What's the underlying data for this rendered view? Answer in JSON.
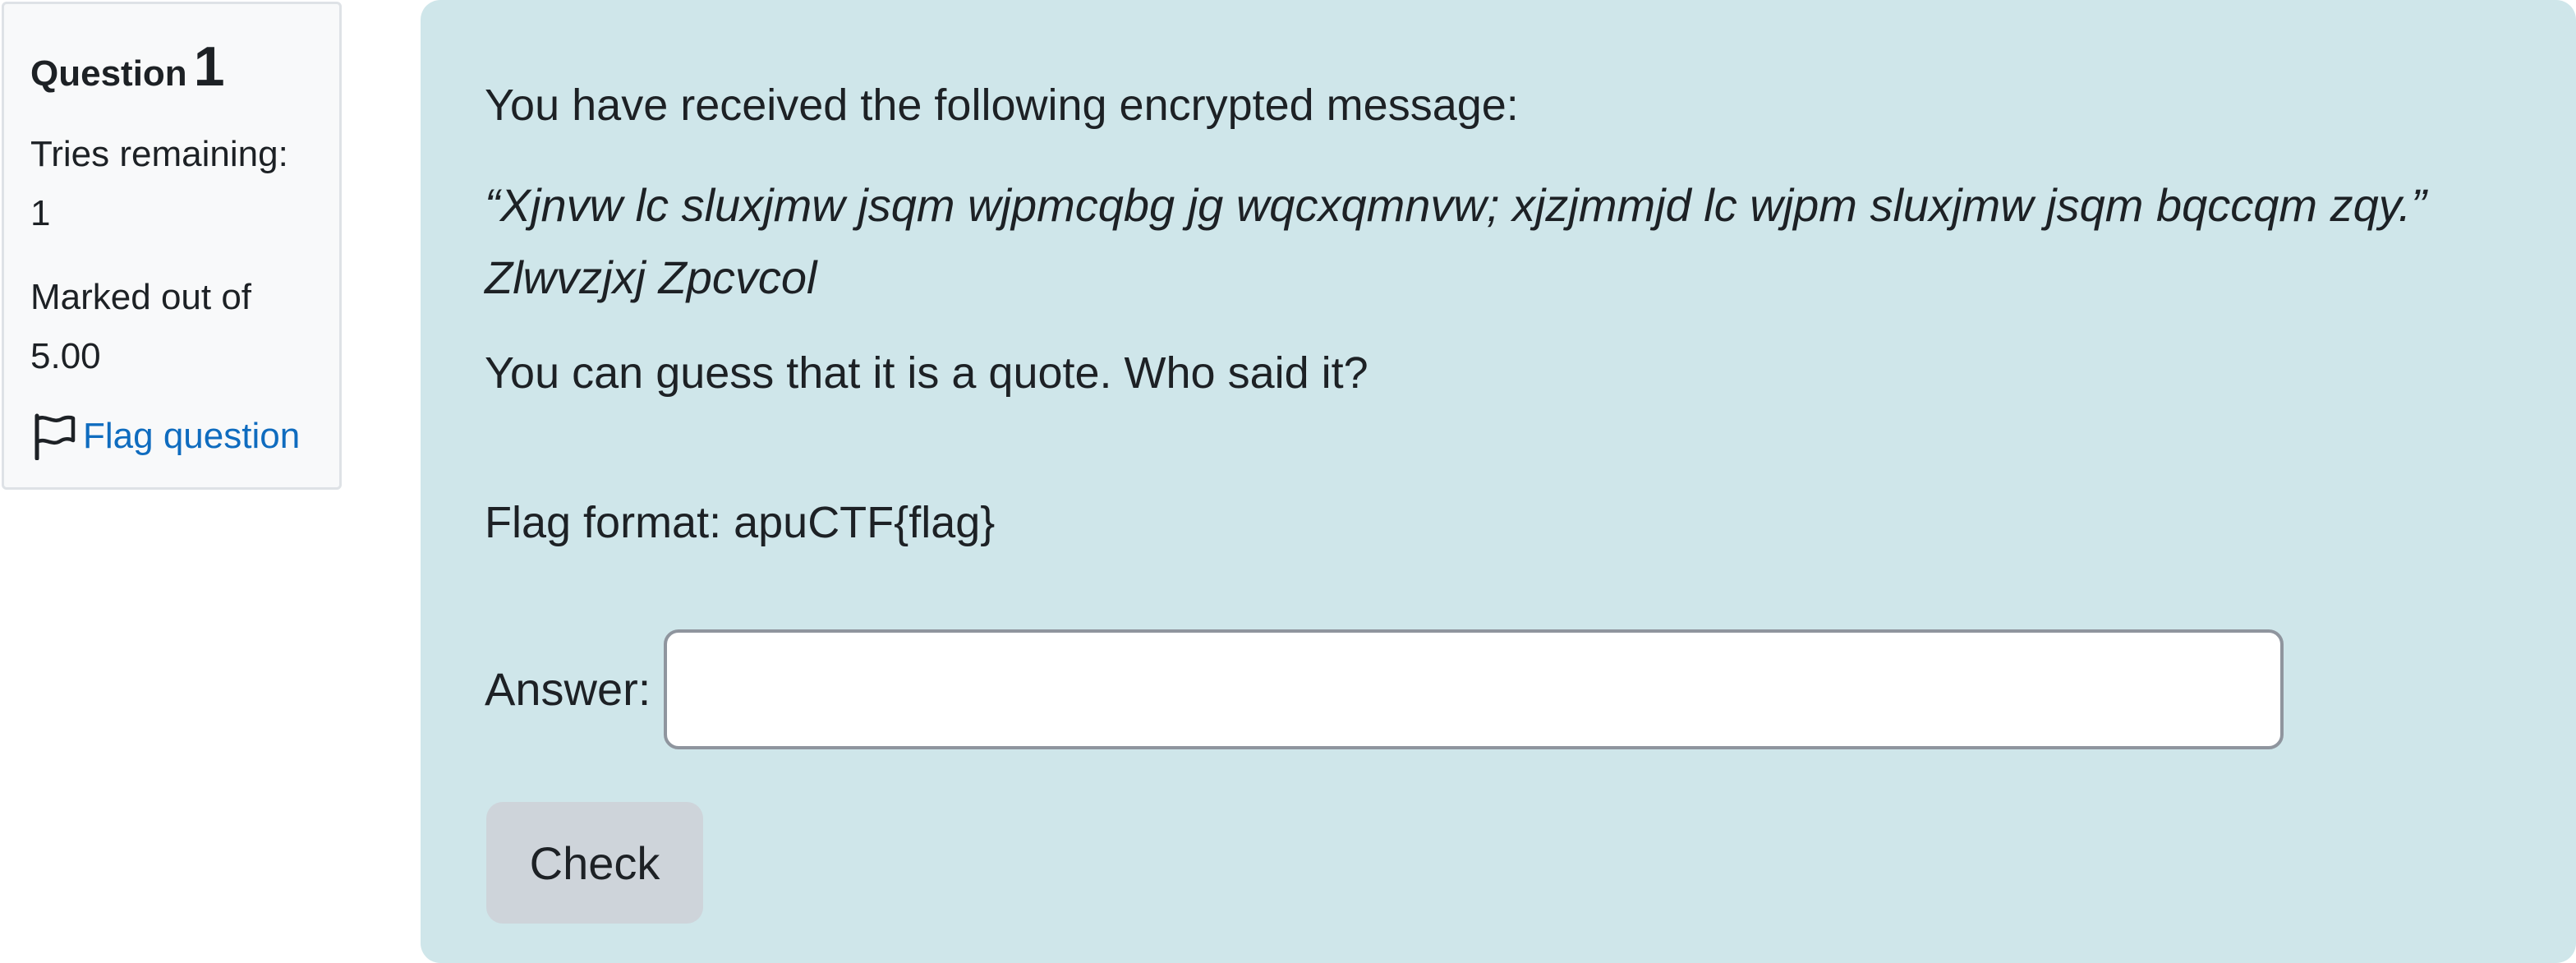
{
  "info": {
    "question_word": "Question",
    "question_number": "1",
    "state": "Tries remaining: 1",
    "grade": "Marked out of 5.00",
    "flag_label": "Flag question",
    "flag_icon": "flag-outline-icon"
  },
  "question": {
    "intro": "You have received the following encrypted message:",
    "quote_line1": "“Xjnvw lc sluxjmw jsqm wjpmcqbg jg wqcxqmnvw; xjzjmmjd lc wjpm sluxjmw jsqm bqccqm zqy.”",
    "quote_line2": "Zlwvzjxj Zpcvcol",
    "hint": "You can guess that it is a quote. Who said it?",
    "flag_format": "Flag format: apuCTF{flag}"
  },
  "answer": {
    "label": "Answer:",
    "value": "",
    "placeholder": ""
  },
  "check_button": {
    "label": "Check"
  },
  "colors": {
    "content_bg": "#cfe6ea",
    "info_bg": "#f8f9fa",
    "link": "#0f6cbf",
    "button_bg": "#ced4da"
  }
}
